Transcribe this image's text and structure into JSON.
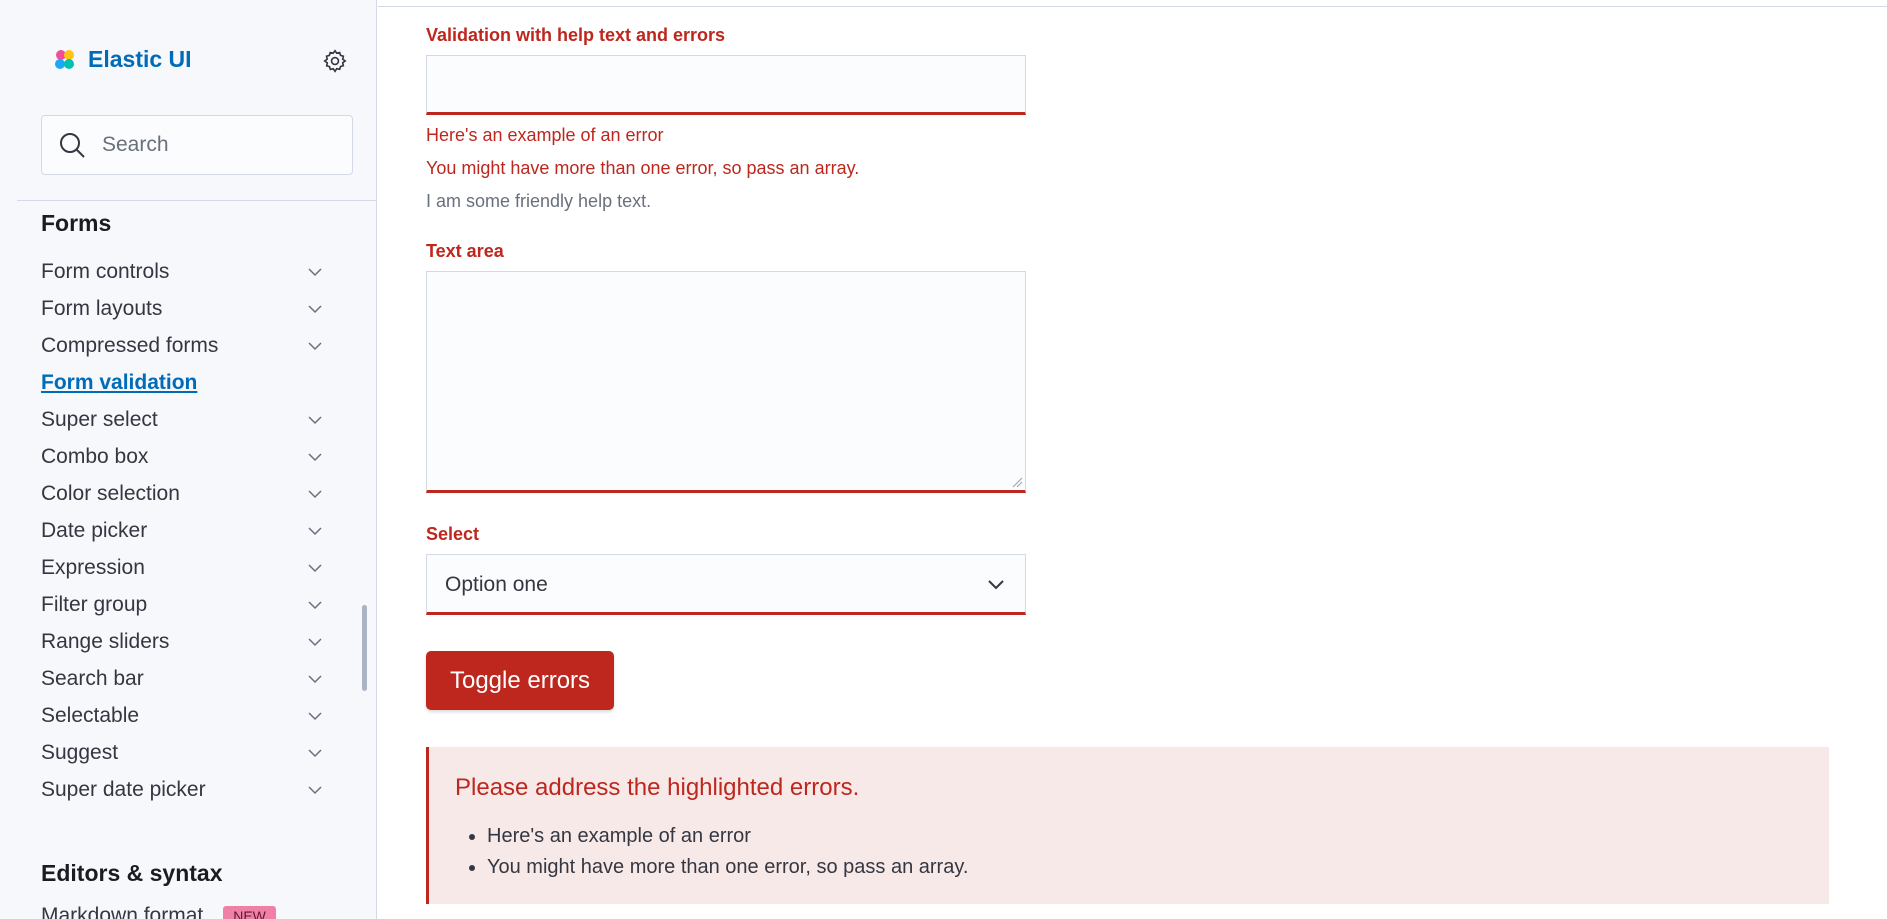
{
  "app": {
    "brand": "Elastic UI",
    "search_placeholder": "Search"
  },
  "sidebar": {
    "forms_title": "Forms",
    "items": [
      {
        "label": "Form controls",
        "expandable": true
      },
      {
        "label": "Form layouts",
        "expandable": true
      },
      {
        "label": "Compressed forms",
        "expandable": true
      },
      {
        "label": "Form validation",
        "expandable": false,
        "active": true
      },
      {
        "label": "Super select",
        "expandable": true
      },
      {
        "label": "Combo box",
        "expandable": true
      },
      {
        "label": "Color selection",
        "expandable": true
      },
      {
        "label": "Date picker",
        "expandable": true
      },
      {
        "label": "Expression",
        "expandable": true
      },
      {
        "label": "Filter group",
        "expandable": true
      },
      {
        "label": "Range sliders",
        "expandable": true
      },
      {
        "label": "Search bar",
        "expandable": true
      },
      {
        "label": "Selectable",
        "expandable": true
      },
      {
        "label": "Suggest",
        "expandable": true
      },
      {
        "label": "Super date picker",
        "expandable": true
      }
    ],
    "editors_title": "Editors & syntax",
    "markdown_label": "Markdown format",
    "new_badge": "NEW"
  },
  "form": {
    "validation_label": "Validation with help text and errors",
    "errors": [
      "Here's an example of an error",
      "You might have more than one error, so pass an array."
    ],
    "help_text": "I am some friendly help text.",
    "textarea_label": "Text area",
    "select_label": "Select",
    "select_value": "Option one",
    "toggle_button": "Toggle errors"
  },
  "callout": {
    "title": "Please address the highlighted errors.",
    "items": [
      "Here's an example of an error",
      "You might have more than one error, so pass an array."
    ]
  },
  "colors": {
    "danger": "#bd271e",
    "primary_link": "#006bb8",
    "callout_bg": "#f8e9e9",
    "sidebar_bg": "#f7f8fc"
  }
}
